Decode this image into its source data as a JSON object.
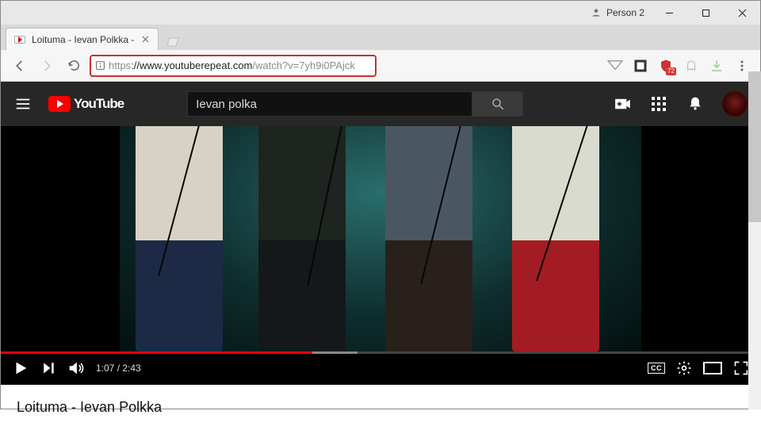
{
  "window": {
    "profile_label": "Person 2"
  },
  "browser": {
    "tab_title": "Loituma - Ievan Polkka -",
    "url_secure": "https",
    "url_host": "://www.youtuberepeat.com",
    "url_path": "/watch?v=7yh9i0PAjck",
    "ext_badge": "72"
  },
  "youtube": {
    "logo_text": "YouTube",
    "search_value": "Ievan polka"
  },
  "player": {
    "current_time": "1:07",
    "duration": "2:43",
    "progress_percent": 41,
    "buffer_start_percent": 41,
    "buffer_end_percent": 47,
    "cc_label": "CC"
  },
  "video": {
    "title": "Loituma - Ievan Polkka"
  }
}
